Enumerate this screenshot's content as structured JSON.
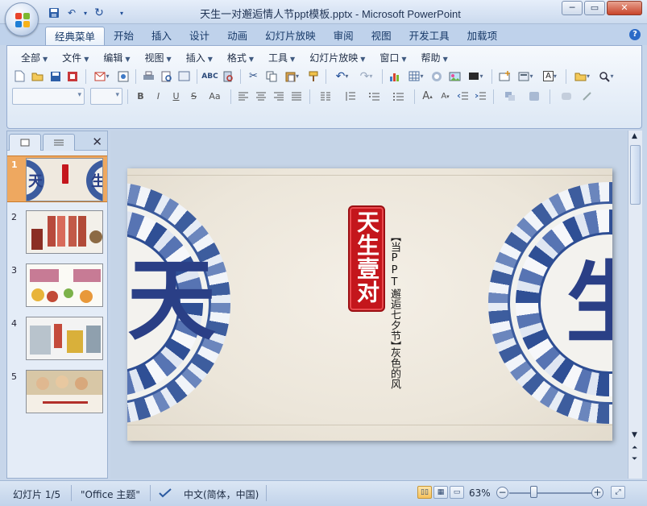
{
  "window": {
    "title": "天生一对邂逅情人节ppt模板.pptx - Microsoft PowerPoint",
    "controls": [
      "minimize",
      "maximize",
      "close"
    ]
  },
  "ribbon_tabs": [
    {
      "label": "经典菜单",
      "active": true
    },
    {
      "label": "开始"
    },
    {
      "label": "插入"
    },
    {
      "label": "设计"
    },
    {
      "label": "动画"
    },
    {
      "label": "幻灯片放映"
    },
    {
      "label": "审阅"
    },
    {
      "label": "视图"
    },
    {
      "label": "开发工具"
    },
    {
      "label": "加载项"
    }
  ],
  "classic_menu": [
    "全部",
    "文件",
    "编辑",
    "视图",
    "插入",
    "格式",
    "工具",
    "幻灯片放映",
    "窗口",
    "帮助"
  ],
  "toolbar": {
    "row1_icons": [
      "new-icon",
      "open-icon",
      "save-icon",
      "permission-icon",
      "email-icon",
      "pdf-icon",
      "print-icon",
      "print-preview-icon",
      "spelling-icon",
      "research-icon",
      "cut-icon",
      "copy-icon",
      "paste-icon",
      "format-painter-icon",
      "undo-icon",
      "redo-icon",
      "chart-icon",
      "table-icon",
      "smartart-icon",
      "picture-icon",
      "shape-icon",
      "textbox-icon",
      "wordart-icon",
      "folder-icon",
      "zoom-icon"
    ],
    "row2_icons": [
      "bold-icon",
      "italic-icon",
      "underline-icon",
      "strikethrough-icon",
      "change-case-icon",
      "align-left-icon",
      "center-icon",
      "align-right-icon",
      "justify-icon",
      "columns-icon",
      "line-spacing-icon",
      "numbering-icon",
      "bullets-icon",
      "font-grow-icon",
      "font-shrink-icon",
      "decrease-indent-icon",
      "increase-indent-icon",
      "arrange-icon",
      "quick-styles-icon",
      "shape-fill-icon",
      "shape-effects-icon"
    ],
    "font_name": "",
    "font_size": "",
    "icon_text": {
      "bold": "B",
      "italic": "I",
      "underline": "U",
      "strike": "S",
      "change_case": "Aa",
      "textbox": "A"
    }
  },
  "slide_panel": {
    "slides": [
      {
        "number": "1",
        "selected": true
      },
      {
        "number": "2"
      },
      {
        "number": "3"
      },
      {
        "number": "4"
      },
      {
        "number": "5"
      }
    ]
  },
  "slide": {
    "title": "天生壹对",
    "subtitle_1": "【当PPT邂逅七夕节】",
    "subtitle_2": "灰色的风",
    "plate_left_char": "天",
    "plate_right_char": "生",
    "colors": {
      "seal": "#c4161c",
      "porcelain_blue": "#2d4d93",
      "paper": "#f0ebe1"
    }
  },
  "statusbar": {
    "slide_info": "幻灯片 1/5",
    "theme": "\"Office 主题\"",
    "language": "中文(简体，中国)",
    "zoom": "63%",
    "zoom_level_percent": 63
  }
}
